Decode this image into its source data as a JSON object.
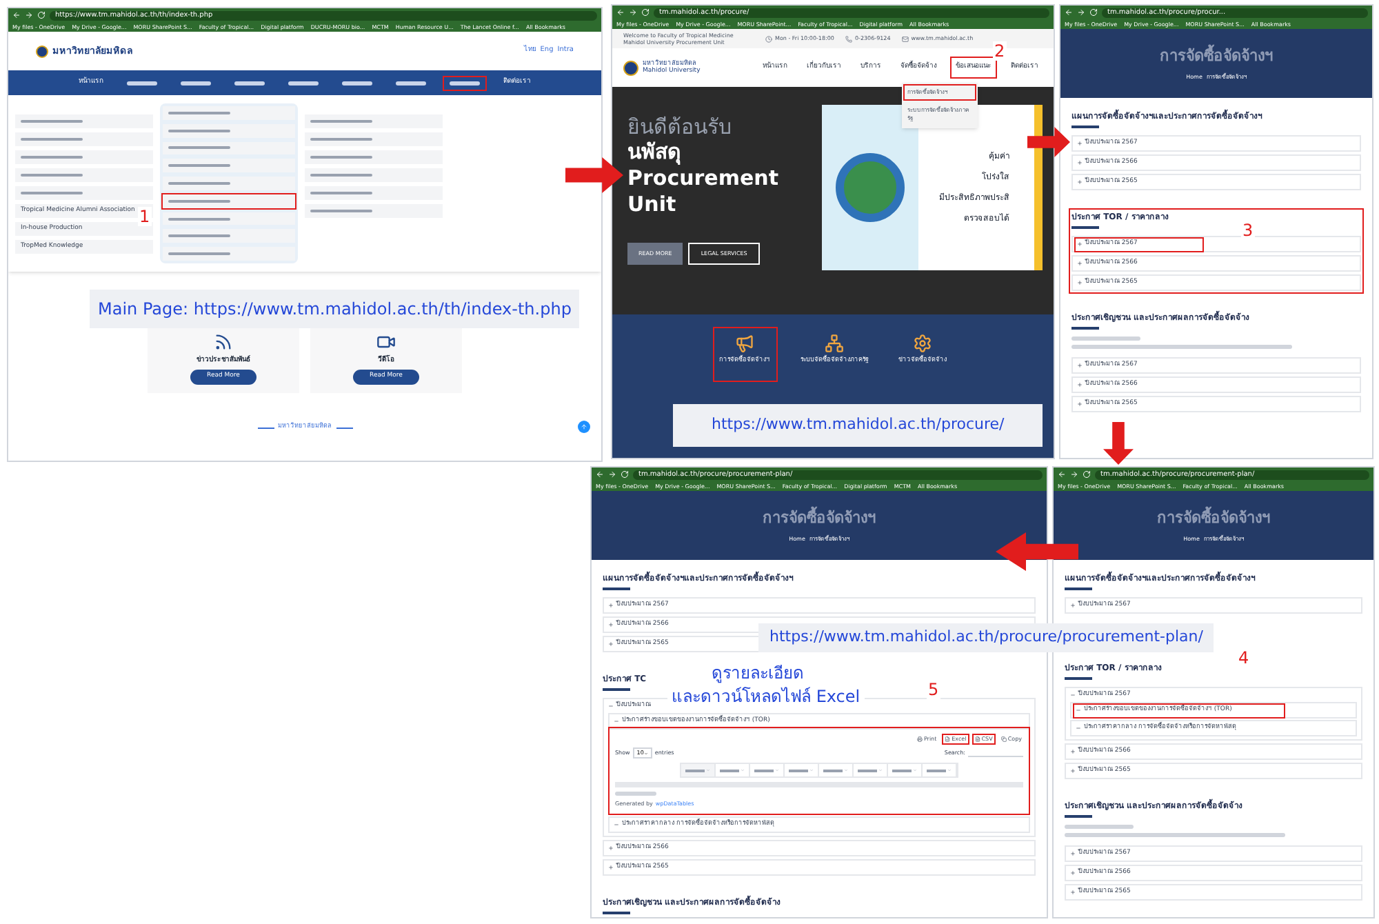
{
  "home_page": {
    "browser": {
      "url": "https://www.tm.mahidol.ac.th/th/index-th.php",
      "bookmarks": [
        "My files - OneDrive",
        "My Drive - Google...",
        "MORU SharePoint S...",
        "Faculty of Tropical...",
        "Digital platform",
        "DUCRU-MORU bio...",
        "MCTM",
        "Human Resource U...",
        "The Lancet Online f...",
        "All Bookmarks"
      ]
    },
    "logo_text": "มหาวิทยาลัยมหิดล",
    "language_links": [
      "ไทย",
      "Eng",
      "Intra"
    ],
    "nav_items": [
      {
        "label": "หน้าแรก",
        "highlighted": false
      },
      {
        "highlighted": false
      },
      {
        "highlighted": false
      },
      {
        "highlighted": false
      },
      {
        "highlighted": false
      },
      {
        "highlighted": false
      },
      {
        "highlighted": false
      },
      {
        "highlighted": true
      },
      {
        "label": "ติดต่อเรา",
        "highlighted": false
      }
    ],
    "menu_columns": [
      {
        "items": [
          {
            "highlighted": false
          },
          {
            "highlighted": false
          },
          {
            "highlighted": false
          },
          {
            "highlighted": false
          },
          {
            "highlighted": false
          },
          {
            "label": "Tropical Medicine Alumni Association",
            "highlighted": false
          },
          {
            "label": "In-house Production",
            "highlighted": false
          },
          {
            "label": "TropMed Knowledge",
            "highlighted": false
          }
        ]
      },
      {
        "items": [
          {
            "highlighted": false
          },
          {
            "highlighted": false
          },
          {
            "highlighted": false
          },
          {
            "highlighted": false
          },
          {
            "highlighted": false
          },
          {
            "highlighted": true
          },
          {
            "highlighted": false
          },
          {
            "highlighted": false
          },
          {
            "highlighted": false
          }
        ]
      },
      {
        "items": [
          {
            "highlighted": false
          },
          {
            "highlighted": false
          },
          {
            "highlighted": false
          },
          {
            "highlighted": false
          },
          {
            "highlighted": false
          },
          {
            "highlighted": false
          }
        ]
      }
    ],
    "cards": [
      {
        "kind": "news",
        "title": "ข่าวประชาสัมพันธ์",
        "button": "Read More"
      },
      {
        "kind": "video",
        "title": "วีดีโอ",
        "button": "Read More"
      }
    ],
    "footer_title": "มหาวิทยาลัยมหิดล"
  },
  "procure_page": {
    "browser": {
      "url": "tm.mahidol.ac.th/procure/",
      "bookmarks": [
        "My files - OneDrive",
        "My Drive - Google...",
        "MORU SharePoint...",
        "Faculty of Tropical...",
        "Digital platform",
        "All Bookmarks"
      ]
    },
    "welcome": "Welcome to Faculty of Tropical Medicine Mahidol University Procurement Unit",
    "hours": "Mon - Fri 10:00-18:00",
    "phone": "0-2306-9124",
    "email": "www.tm.mahidol.ac.th",
    "logo_lines": [
      "มหาวิทยาลัยมหิดล",
      "Mahidol University"
    ],
    "nav_items": [
      {
        "label": "หน้าแรก",
        "highlighted": false
      },
      {
        "label": "เกี่ยวกับเรา",
        "highlighted": false
      },
      {
        "label": "บริการ",
        "highlighted": false
      },
      {
        "label": "จัดซื้อจัดจ้าง",
        "highlighted": false
      },
      {
        "label": "ข้อเสนอแนะ",
        "highlighted": true
      },
      {
        "label": "ติดต่อเรา",
        "highlighted": false
      }
    ],
    "dropdown": [
      {
        "label": "การจัดซื้อจัดจ้างฯ",
        "highlighted": true
      },
      {
        "label": "ระบบการจัดซื้อจัดจ้างภาครัฐ",
        "highlighted": false
      }
    ],
    "hero": {
      "greeting": "ยินดีต้อนรับ",
      "title_lines": [
        "นพัสดุ",
        "Procurement",
        "Unit"
      ],
      "buttons": [
        {
          "label": "READ MORE",
          "kind": "filled"
        },
        {
          "label": "LEGAL SERVICES",
          "kind": "outline"
        }
      ],
      "slogans": [
        "คุ้มค่า",
        "โปร่งใส",
        "มีประสิทธิภาพประสิ",
        "ตรวจสอบได้"
      ]
    },
    "services": [
      {
        "kind": "megaphone",
        "label": "การจัดซื้อจัดจ้างฯ",
        "highlighted": true
      },
      {
        "kind": "network",
        "label": "ระบบจัดซื้อจัดจ้างภาครัฐ",
        "highlighted": false
      },
      {
        "kind": "gear",
        "label": "ข่าวจัดซื้อจัดจ้าง",
        "highlighted": false
      }
    ]
  },
  "plan_pages": [
    {
      "browser": {
        "url": "tm.mahidol.ac.th/procure/procur...",
        "bookmarks": [
          "My files - OneDrive",
          "My Drive - Google...",
          "MORU SharePoint S...",
          "All Bookmarks"
        ]
      },
      "banner_title": "การจัดซื้อจัดจ้างฯ",
      "breadcrumb": [
        "Home",
        "การจัดซื้อจัดจ้างฯ"
      ],
      "sections": [
        {
          "title": "แผนการจัดซื้อจัดจ้างฯและประกาศการจัดซื้อจัดจ้างฯ",
          "highlighted": false,
          "has_note": false,
          "items": [
            {
              "label": "ปีงบประมาณ 2567",
              "expanded": false,
              "highlighted": false
            },
            {
              "label": "ปีงบประมาณ 2566",
              "expanded": false,
              "highlighted": false
            },
            {
              "label": "ปีงบประมาณ 2565",
              "expanded": false,
              "highlighted": false
            }
          ]
        },
        {
          "title": "ประกาศ TOR / ราคากลาง",
          "highlighted": true,
          "has_note": false,
          "items": [
            {
              "label": "ปีงบประมาณ 2567",
              "expanded": false,
              "highlighted": true
            },
            {
              "label": "ปีงบประมาณ 2566",
              "expanded": false,
              "highlighted": false
            },
            {
              "label": "ปีงบประมาณ 2565",
              "expanded": false,
              "highlighted": false
            }
          ]
        },
        {
          "title": "ประกาศเชิญชวน และประกาศผลการจัดซื้อจัดจ้าง",
          "highlighted": false,
          "has_note": true,
          "items": [
            {
              "label": "ปีงบประมาณ 2567",
              "expanded": false,
              "highlighted": false
            },
            {
              "label": "ปีงบประมาณ 2566",
              "expanded": false,
              "highlighted": false
            },
            {
              "label": "ปีงบประมาณ 2565",
              "expanded": false,
              "highlighted": false
            }
          ]
        }
      ]
    },
    {
      "browser": {
        "url": "tm.mahidol.ac.th/procure/procurement-plan/",
        "bookmarks": [
          "My files - OneDrive",
          "My Drive - Google...",
          "MORU SharePoint S...",
          "Faculty of Tropical...",
          "Digital platform",
          "MCTM",
          "All Bookmarks"
        ]
      },
      "banner_title": "การจัดซื้อจัดจ้างฯ",
      "breadcrumb": [
        "Home",
        "การจัดซื้อจัดจ้างฯ"
      ],
      "sections": [
        {
          "title": "แผนการจัดซื้อจัดจ้างฯและประกาศการจัดซื้อจัดจ้างฯ",
          "highlighted": false,
          "has_note": false,
          "items": [
            {
              "label": "ปีงบประมาณ 2567",
              "expanded": false,
              "highlighted": false
            },
            {
              "label": "ปีงบประมาณ 2566",
              "expanded": false,
              "highlighted": false
            },
            {
              "label": "ปีงบประมาณ 2565",
              "expanded": false,
              "highlighted": false
            }
          ]
        },
        {
          "title": "ประกาศ TC",
          "highlighted": false,
          "has_note": false,
          "items": [
            {
              "label": "ปีงบประมาณ",
              "expanded": true,
              "highlighted": false,
              "children": [
                {
                  "label": "ประกาศร่างขอบเขตของงานการจัดซื้อจัดจ้างฯ (TOR)",
                  "expanded": true,
                  "highlighted": true,
                  "table": {
                    "buttons": [
                      {
                        "label": "Print",
                        "highlighted": false
                      },
                      {
                        "label": "Excel",
                        "highlighted": true
                      },
                      {
                        "label": "CSV",
                        "highlighted": true
                      },
                      {
                        "label": "Copy",
                        "highlighted": false
                      }
                    ],
                    "show_label": "Show",
                    "page_size": "10",
                    "entries_label": "entries",
                    "search_label": "Search:",
                    "generated_by": "Generated by",
                    "generator_link": "wpDataTables"
                  }
                },
                {
                  "label": "ประกาศราคากลาง การจัดซื้อจัดจ้างหรือการจัดหาพัสดุ",
                  "expanded": true,
                  "highlighted": false
                }
              ]
            },
            {
              "label": "ปีงบประมาณ 2566",
              "expanded": false,
              "highlighted": false
            },
            {
              "label": "ปีงบประมาณ 2565",
              "expanded": false,
              "highlighted": false
            }
          ]
        },
        {
          "title": "ประกาศเชิญชวน และประกาศผลการจัดซื้อจัดจ้าง",
          "highlighted": false,
          "has_note": false
        }
      ]
    },
    {
      "browser": {
        "url": "tm.mahidol.ac.th/procure/procurement-plan/",
        "bookmarks": [
          "My files - OneDrive",
          "MORU SharePoint S...",
          "Faculty of Tropical...",
          "All Bookmarks"
        ]
      },
      "banner_title": "การจัดซื้อจัดจ้างฯ",
      "breadcrumb": [
        "Home",
        "การจัดซื้อจัดจ้างฯ"
      ],
      "sections": [
        {
          "title": "แผนการจัดซื้อจัดจ้างฯและประกาศการจัดซื้อจัดจ้างฯ",
          "highlighted": false,
          "has_note": false,
          "items": [
            {
              "label": "ปีงบประมาณ 2567",
              "expanded": false,
              "highlighted": false
            }
          ]
        },
        {
          "title": "ประกาศ TOR / ราคากลาง",
          "highlighted": false,
          "has_note": false,
          "items": [
            {
              "label": "ปีงบประมาณ 2567",
              "expanded": true,
              "highlighted": false,
              "children": [
                {
                  "label": "ประกาศร่างขอบเขตของงานการจัดซื้อจัดจ้างฯ (TOR)",
                  "expanded": true,
                  "highlighted": true
                },
                {
                  "label": "ประกาศราคากลาง การจัดซื้อจัดจ้างหรือการจัดหาพัสดุ",
                  "expanded": true,
                  "highlighted": false
                }
              ]
            },
            {
              "label": "ปีงบประมาณ 2566",
              "expanded": false,
              "highlighted": false
            },
            {
              "label": "ปีงบประมาณ 2565",
              "expanded": false,
              "highlighted": false
            }
          ]
        },
        {
          "title": "ประกาศเชิญชวน และประกาศผลการจัดซื้อจัดจ้าง",
          "highlighted": false,
          "has_note": true,
          "items": [
            {
              "label": "ปีงบประมาณ 2567",
              "expanded": false,
              "highlighted": false
            },
            {
              "label": "ปีงบประมาณ 2566",
              "expanded": false,
              "highlighted": false
            },
            {
              "label": "ปีงบประมาณ 2565",
              "expanded": false,
              "highlighted": false
            }
          ]
        }
      ]
    }
  ],
  "captions": [
    "Main Page: https://www.tm.mahidol.ac.th/th/index-th.php",
    "https://www.tm.mahidol.ac.th/procure/",
    "https://www.tm.mahidol.ac.th/procure/procurement-plan/"
  ],
  "step_numbers": [
    "1",
    "2",
    "3",
    "4",
    "5"
  ],
  "instruction_lines": [
    "ดูรายละเอียด",
    "และดาวน์โหลดไฟล์ Excel"
  ]
}
